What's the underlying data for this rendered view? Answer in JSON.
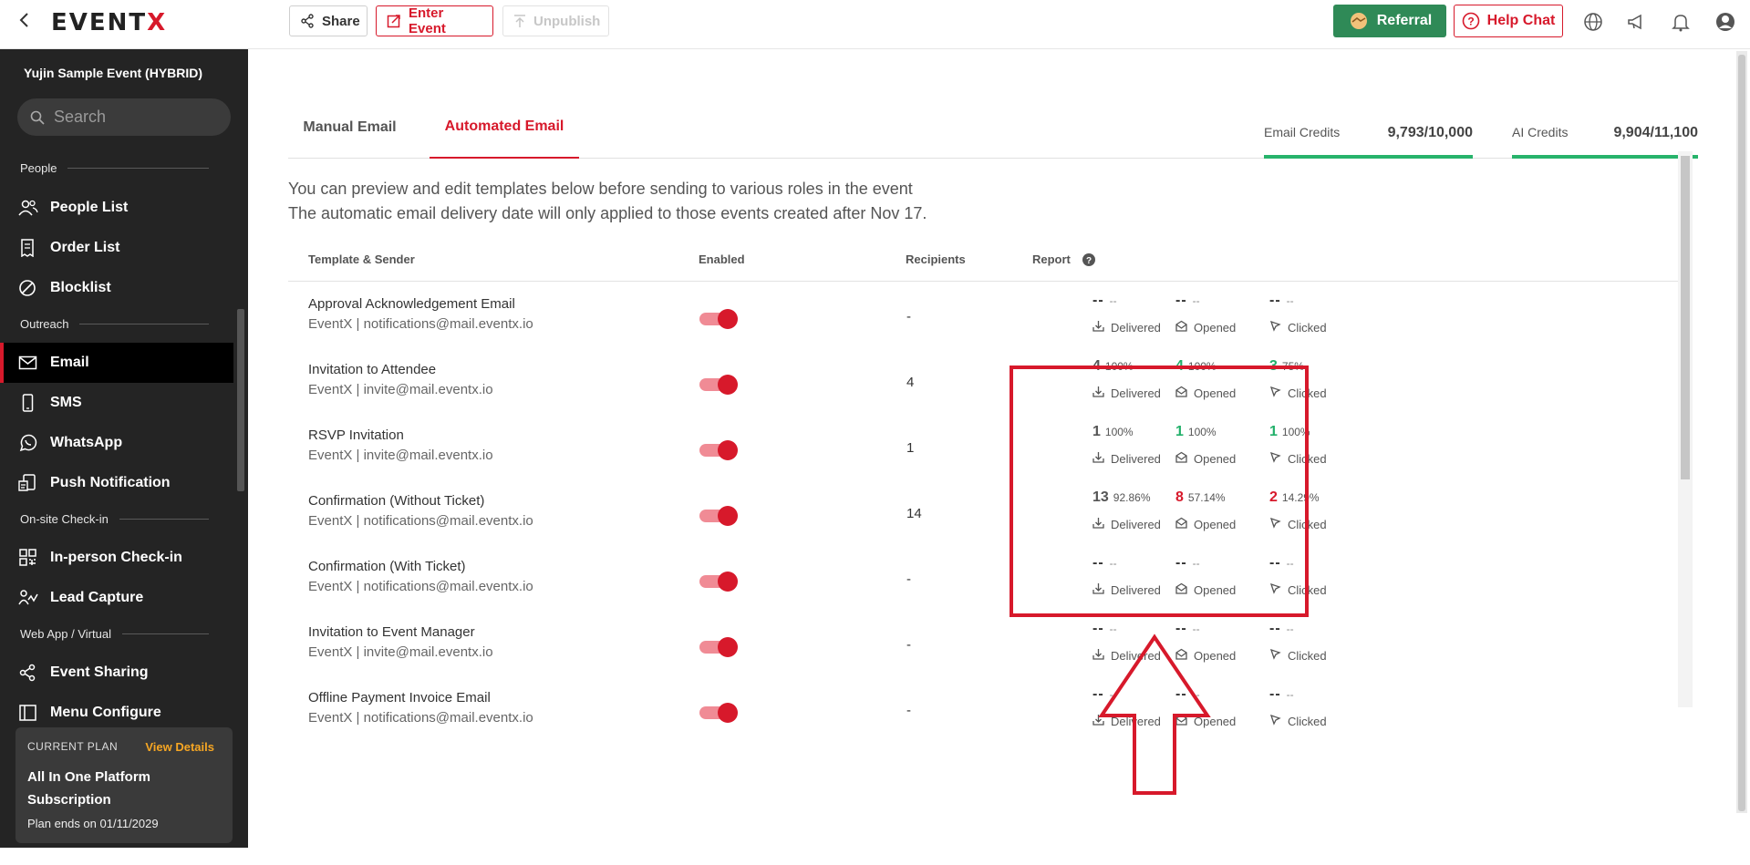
{
  "topbar": {
    "logo_prefix": "EVENT",
    "logo_x": "X",
    "share": "Share",
    "enter_event": "Enter Event",
    "unpublish": "Unpublish",
    "referral": "Referral",
    "help_chat": "Help Chat"
  },
  "sidebar": {
    "event_name": "Yujin Sample Event (HYBRID)",
    "search_placeholder": "Search",
    "sections": {
      "people": "People",
      "outreach": "Outreach",
      "onsite": "On-site Check-in",
      "webapp": "Web App / Virtual"
    },
    "items": {
      "people_list": "People List",
      "order_list": "Order List",
      "blocklist": "Blocklist",
      "email": "Email",
      "sms": "SMS",
      "whatsapp": "WhatsApp",
      "push": "Push Notification",
      "inperson": "In-person Check-in",
      "lead": "Lead Capture",
      "sharing": "Event Sharing",
      "menu": "Menu Configure"
    },
    "plan": {
      "current_label": "CURRENT PLAN",
      "view_details": "View Details",
      "name": "All In One Platform Subscription",
      "ends": "Plan ends on 01/11/2029"
    }
  },
  "main": {
    "tabs": {
      "manual": "Manual Email",
      "automated": "Automated Email"
    },
    "credits": {
      "email_label": "Email Credits",
      "email_value": "9,793/10,000",
      "ai_label": "AI Credits",
      "ai_value": "9,904/11,100"
    },
    "intro_line1": "You can preview and edit templates below before sending to various roles in the event",
    "intro_line2": "The automatic email delivery date will only applied to those events created after Nov 17.",
    "table": {
      "headers": {
        "template": "Template & Sender",
        "enabled": "Enabled",
        "recipients": "Recipients",
        "report": "Report"
      },
      "labels": {
        "delivered": "Delivered",
        "opened": "Opened",
        "clicked": "Clicked",
        "dash": "--"
      },
      "rows": [
        {
          "name": "Approval Acknowledgement Email",
          "sender": "EventX | notifications@mail.eventx.io",
          "recipients": "-"
        },
        {
          "name": "Invitation to Attendee",
          "sender": "EventX | invite@mail.eventx.io",
          "recipients": "4",
          "delivered": "4",
          "delivered_pct": "100%",
          "opened": "4",
          "opened_pct": "100%",
          "clicked": "3",
          "clicked_pct": "75%"
        },
        {
          "name": "RSVP Invitation",
          "sender": "EventX | invite@mail.eventx.io",
          "recipients": "1",
          "delivered": "1",
          "delivered_pct": "100%",
          "opened": "1",
          "opened_pct": "100%",
          "clicked": "1",
          "clicked_pct": "100%"
        },
        {
          "name": "Confirmation (Without Ticket)",
          "sender": "EventX | notifications@mail.eventx.io",
          "recipients": "14",
          "delivered": "13",
          "delivered_pct": "92.86%",
          "opened": "8",
          "opened_pct": "57.14%",
          "clicked": "2",
          "clicked_pct": "14.29%"
        },
        {
          "name": "Confirmation (With Ticket)",
          "sender": "EventX | notifications@mail.eventx.io",
          "recipients": "-"
        },
        {
          "name": "Invitation to Event Manager",
          "sender": "EventX | invite@mail.eventx.io",
          "recipients": "-"
        },
        {
          "name": "Offline Payment Invoice Email",
          "sender": "EventX | notifications@mail.eventx.io",
          "recipients": "-"
        }
      ]
    }
  },
  "colors": {
    "brand_red": "#d7192b",
    "green": "#22b06a",
    "referral_green": "#2f8a57",
    "sidebar_bg": "#242424"
  }
}
